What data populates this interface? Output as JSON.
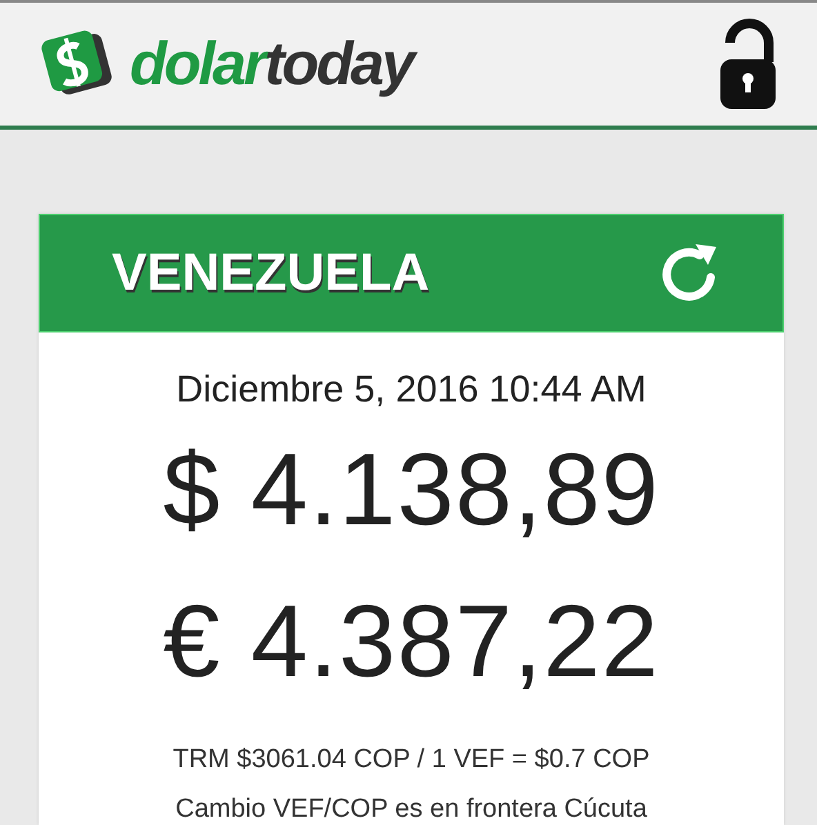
{
  "header": {
    "logo": {
      "first": "dolar",
      "second": "today"
    },
    "lock": {
      "locked": false
    }
  },
  "card": {
    "title": "VENEZUELA",
    "date": "Diciembre 5, 2016 10:44 AM",
    "rates": [
      {
        "symbol": "$",
        "value": "4.138,89"
      },
      {
        "symbol": "€",
        "value": "4.387,22"
      }
    ],
    "notes": [
      "TRM $3061.04 COP / 1 VEF = $0.7 COP",
      "Cambio VEF/COP es en frontera Cúcuta"
    ]
  }
}
